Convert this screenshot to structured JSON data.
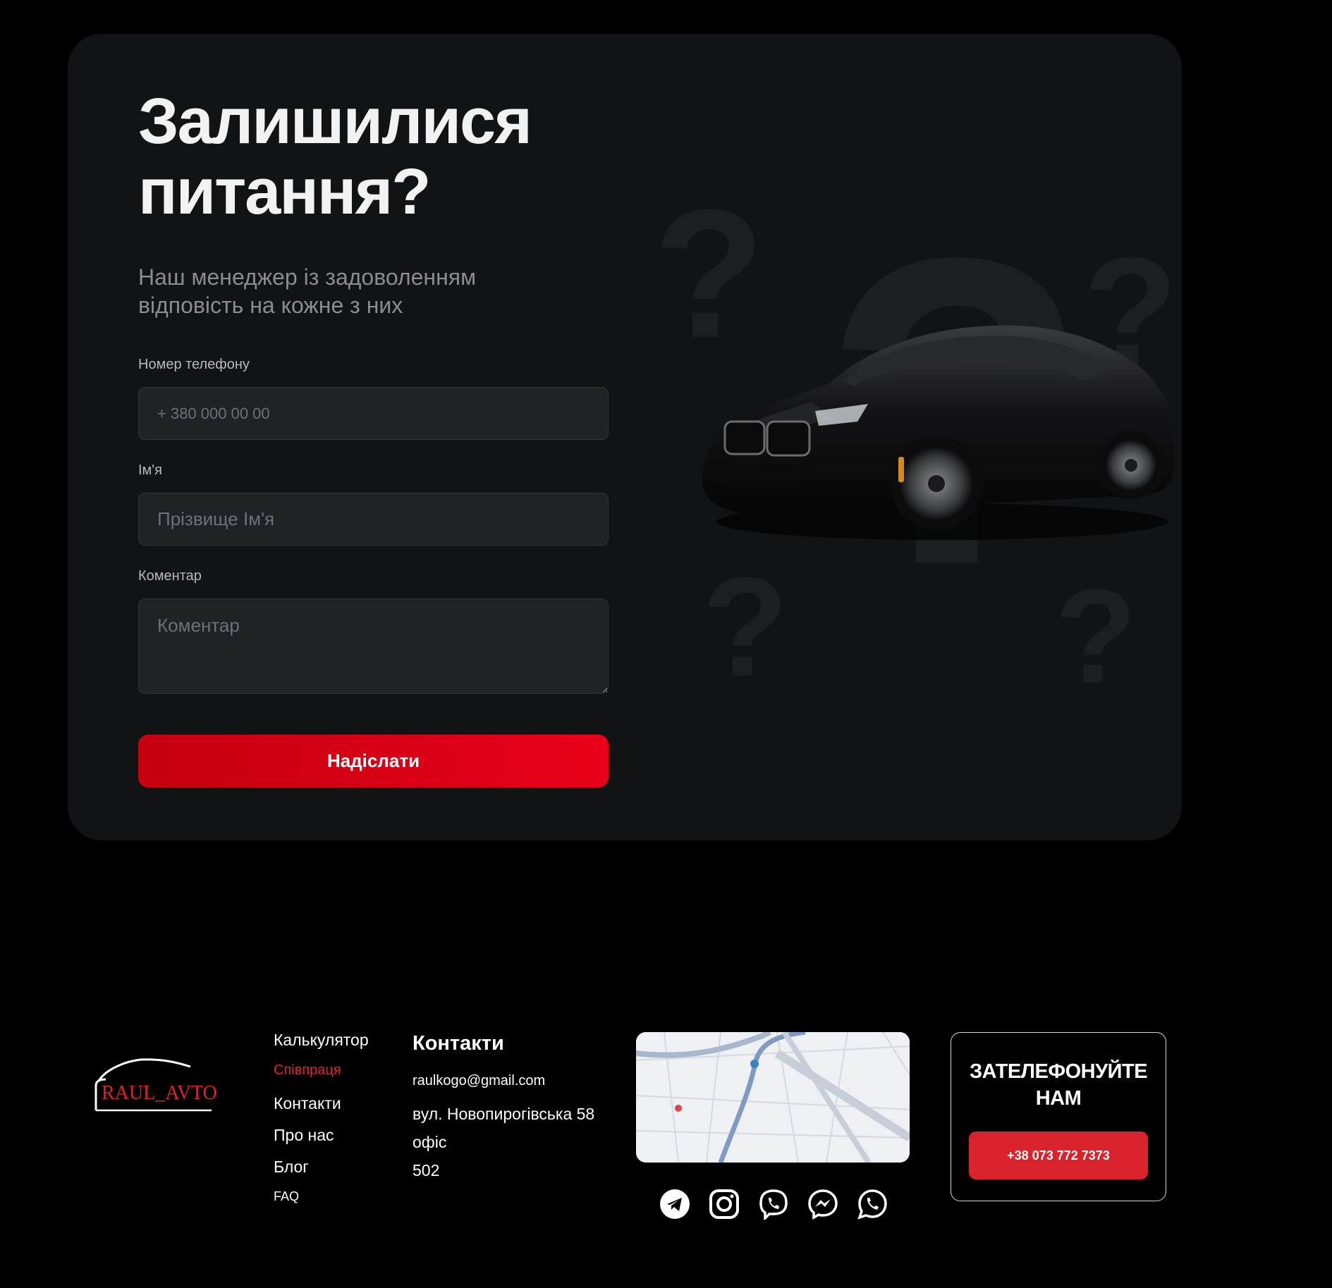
{
  "form": {
    "title_line1": "Залишилися",
    "title_line2": "питання?",
    "subtitle_line1": "Наш менеджер із задоволенням",
    "subtitle_line2": "відповість на кожне з них",
    "phone_label": "Номер телефону",
    "phone_placeholder": "+ 380 000 00 00",
    "name_label": "Ім'я",
    "name_placeholder": "Прізвище Ім'я",
    "comment_label": "Коментар",
    "comment_placeholder": "Коментар",
    "submit_label": "Надіслати"
  },
  "footer": {
    "logo_text": "RAUL_AVTO",
    "nav": [
      {
        "label": "Калькулятор"
      },
      {
        "label": "Співпраця"
      },
      {
        "label": "Контакти"
      },
      {
        "label": "Про нас"
      },
      {
        "label": "Блог"
      },
      {
        "label": "FAQ"
      }
    ],
    "contacts_title": "Контакти",
    "email": "raulkogo@gmail.com",
    "address_line1": "вул. Новопирогівська 58",
    "address_line2": "офіс",
    "address_line3": "502",
    "socials": [
      "telegram-icon",
      "instagram-icon",
      "viber-icon",
      "messenger-icon",
      "whatsapp-icon"
    ],
    "call_title_line1": "ЗАТЕЛЕФОНУЙТЕ",
    "call_title_line2": "НАМ",
    "call_phone": "+38 073 772 7373"
  },
  "colors": {
    "background": "#000000",
    "card": "#121315",
    "input": "#212226",
    "accent_red": "#e80019",
    "active_link": "#e8232e"
  }
}
